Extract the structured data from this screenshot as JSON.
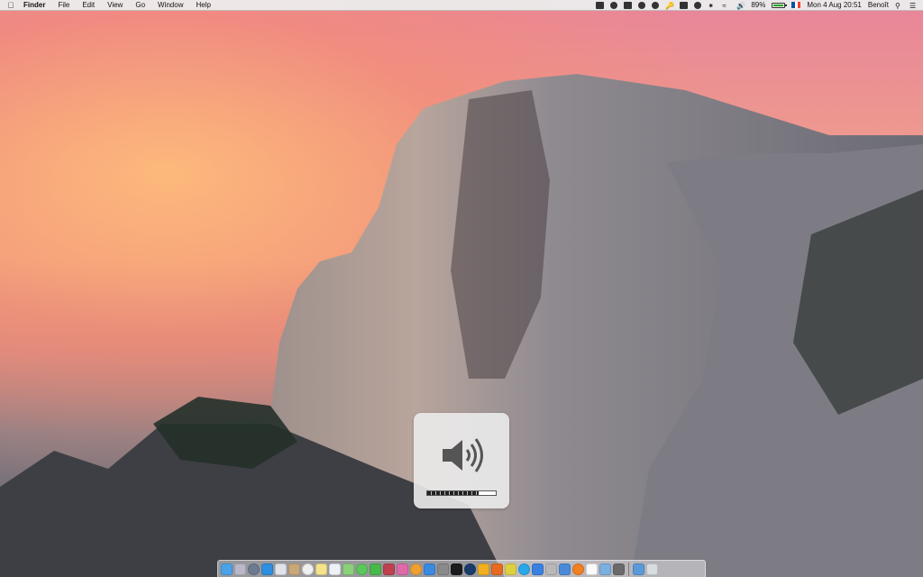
{
  "menubar": {
    "apple_icon": "apple-icon",
    "app_name": "Finder",
    "menus": [
      "File",
      "Edit",
      "View",
      "Go",
      "Window",
      "Help"
    ],
    "status": {
      "battery_percent": "89%",
      "datetime": "Mon 4 Aug  20:51",
      "user": "Benoît"
    }
  },
  "volume_hud": {
    "icon": "speaker-volume-icon",
    "level": 0.75
  },
  "dock": {
    "apps": [
      "finder",
      "launchpad",
      "mission-control",
      "safari",
      "mail",
      "contacts",
      "calendar",
      "notes",
      "reminders",
      "maps",
      "messages",
      "facetime",
      "photo-booth",
      "itunes",
      "ibooks",
      "app-store",
      "system-preferences",
      "terminal",
      "photoshop",
      "sketch",
      "firefox",
      "chrome",
      "skype",
      "dropbox",
      "transmission",
      "xcode",
      "vlc",
      "textedit",
      "preview",
      "activity-monitor"
    ],
    "right_items": [
      "downloads-stack",
      "trash"
    ]
  },
  "colors": {
    "menubar_bg": "#ececec",
    "battery_fill": "#22aa22",
    "hud_bg": "#ebebeb"
  }
}
